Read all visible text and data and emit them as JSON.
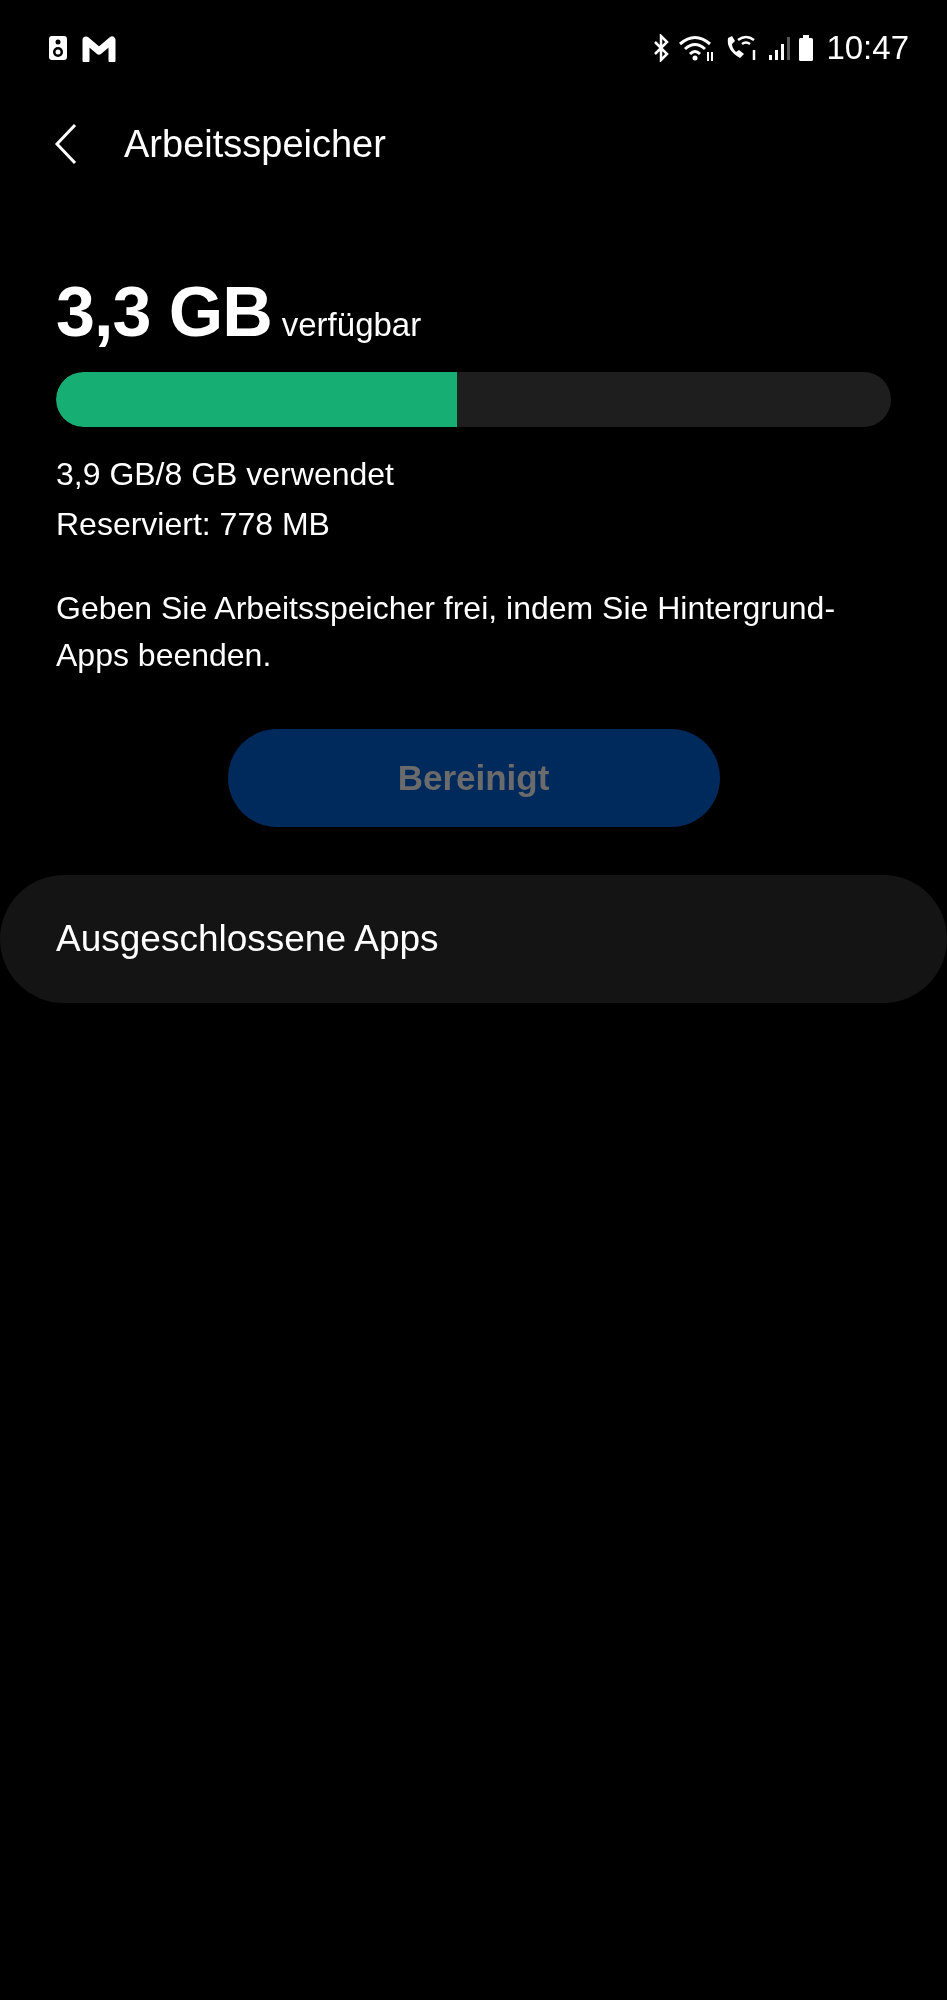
{
  "status_bar": {
    "time": "10:47"
  },
  "header": {
    "title": "Arbeitsspeicher"
  },
  "memory": {
    "available": "3,3 GB",
    "available_label": "verfügbar",
    "level": 0.48,
    "used": "3,9 GB/8 GB verwendet",
    "reserved": "Reserviert: 778 MB"
  },
  "description": "Geben Sie Arbeitsspeicher frei, indem Sie Hintergrund-Apps beenden.",
  "button": {
    "label": "Bereinigt",
    "disabled": true
  },
  "list_items": [
    {
      "label": "Ausgeschlossene Apps"
    }
  ]
}
